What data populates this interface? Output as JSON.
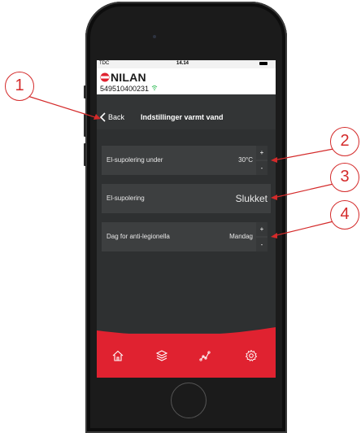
{
  "status_bar": {
    "carrier": "TDC",
    "time": "14.14"
  },
  "header": {
    "logo_text": "NILAN",
    "device_id": "549510400231"
  },
  "nav": {
    "back_label": "Back",
    "title": "Indstillinger varmt vand"
  },
  "settings": [
    {
      "label": "El-supolering under",
      "value": "30°C",
      "plus": "+",
      "minus": "-"
    },
    {
      "label": "El-supolering",
      "value": "Slukket"
    },
    {
      "label": "Dag for anti-legionella",
      "value": "Mandag",
      "plus": "+",
      "minus": "-"
    }
  ],
  "footer_tabs": [
    "home-icon",
    "layers-icon",
    "graph-icon",
    "gear-icon"
  ],
  "callouts": [
    "1",
    "2",
    "3",
    "4"
  ],
  "colors": {
    "accent": "#e02230",
    "callout": "#d42a2a",
    "background": "#333536"
  }
}
